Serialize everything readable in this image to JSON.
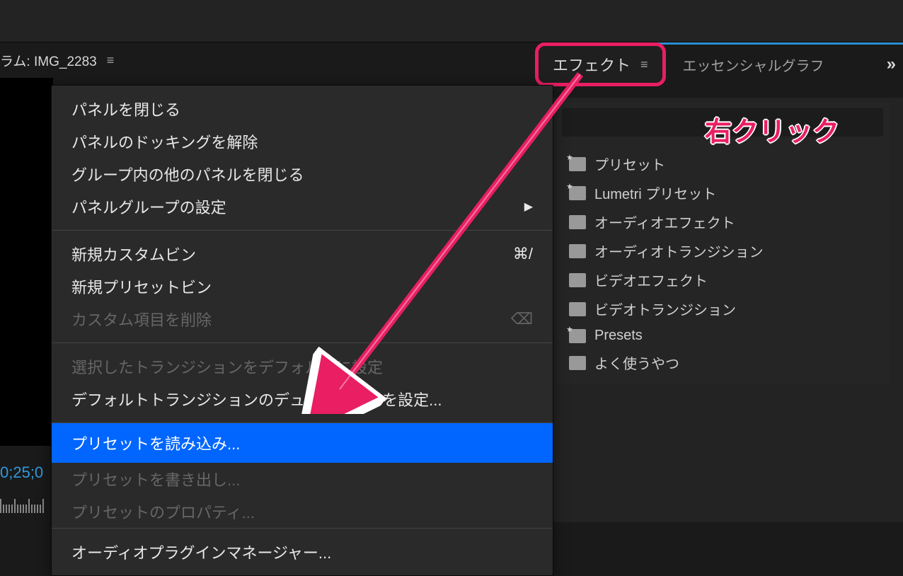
{
  "header": {
    "program_label": "ラム: IMG_2283"
  },
  "tabs": {
    "effects": "エフェクト",
    "essential_graphics": "エッセンシャルグラフ"
  },
  "annotation": {
    "right_click": "右クリック"
  },
  "context_menu": {
    "close_panel": "パネルを閉じる",
    "undock_panel": "パネルのドッキングを解除",
    "close_other_panels": "グループ内の他のパネルを閉じる",
    "panel_group_settings": "パネルグループの設定",
    "new_custom_bin": "新規カスタムビン",
    "new_custom_bin_shortcut": "⌘/",
    "new_preset_bin": "新規プリセットビン",
    "delete_custom_item": "カスタム項目を削除",
    "set_default_transition": "選択したトランジションをデフォルトに設定",
    "default_transition_duration": "デフォルトトランジションのデュレーションを設定...",
    "import_preset": "プリセットを読み込み...",
    "export_preset": "プリセットを書き出し...",
    "preset_properties": "プリセットのプロパティ...",
    "audio_plugin_manager": "オーディオプラグインマネージャー..."
  },
  "effects_tree": {
    "items": [
      {
        "label": "プリセット",
        "starred": true
      },
      {
        "label": "Lumetri プリセット",
        "starred": true
      },
      {
        "label": "オーディオエフェクト",
        "starred": false
      },
      {
        "label": "オーディオトランジション",
        "starred": false
      },
      {
        "label": "ビデオエフェクト",
        "starred": false
      },
      {
        "label": "ビデオトランジション",
        "starred": false
      },
      {
        "label": "Presets",
        "starred": true
      },
      {
        "label": "よく使うやつ",
        "starred": false
      }
    ]
  },
  "timeline": {
    "timecode": "0;25;0"
  },
  "colors": {
    "accent_pink": "#e91e63",
    "highlight_blue": "#0066ff",
    "timecode_blue": "#3099dd"
  }
}
